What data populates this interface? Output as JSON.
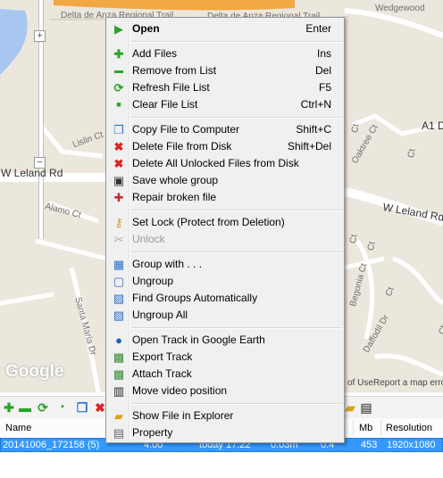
{
  "map": {
    "labels": {
      "delta_top": "Delta de Anza Regional Trail",
      "delta_mid": "Delta de Anza Regional Trail",
      "wedgewood": "Wedgewood",
      "w_leland_left": "W Leland Rd",
      "w_leland_right": "W Leland Rd",
      "lislin": "Lislin Ct",
      "alamo": "Alamo Ct",
      "santa_maria": "Santa Maria Dr",
      "oaktree": "Oaktree Ct",
      "a1_do": "A1 Do",
      "begonia": "Begonia Ct",
      "daffodil": "Daffodil Dr",
      "ct_a": "Ct",
      "ct_b": "Ct",
      "ct_c": "Ct",
      "ct_d": "Ct",
      "ct_e": "Ct",
      "ct_f": "Ct"
    },
    "zoom_in": "+",
    "zoom_out": "−",
    "logo": "Google",
    "terms": "of Use",
    "report": "Report a map erro"
  },
  "list": {
    "columns": {
      "name": "Name",
      "mb": "Mb",
      "resolution": "Resolution"
    },
    "row": {
      "name": "20141006_172158 (5)",
      "value": "4.00",
      "date": "today 17:22",
      "duration": "0.03m",
      "num": "0.4",
      "mb": "453",
      "resolution": "1920x1080"
    }
  },
  "menu": {
    "open": {
      "label": "Open",
      "shortcut": "Enter"
    },
    "add_files": {
      "label": "Add Files",
      "shortcut": "Ins"
    },
    "remove_from_list": {
      "label": "Remove from List",
      "shortcut": "Del"
    },
    "refresh_file_list": {
      "label": "Refresh File List",
      "shortcut": "F5"
    },
    "clear_file_list": {
      "label": "Clear File List",
      "shortcut": "Ctrl+N"
    },
    "copy_file_to_computer": {
      "label": "Copy File to Computer",
      "shortcut": "Shift+C"
    },
    "delete_file_from_disk": {
      "label": "Delete File from Disk",
      "shortcut": "Shift+Del"
    },
    "delete_all_unlocked": {
      "label": "Delete All Unlocked Files from Disk"
    },
    "save_whole_group": {
      "label": "Save whole group"
    },
    "repair_broken_file": {
      "label": "Repair broken file"
    },
    "set_lock": {
      "label": "Set Lock (Protect from Deletion)"
    },
    "unlock": {
      "label": "Unlock"
    },
    "group_with": {
      "label": "Group with . . ."
    },
    "ungroup": {
      "label": "Ungroup"
    },
    "find_groups": {
      "label": "Find Groups Automatically"
    },
    "ungroup_all": {
      "label": "Ungroup All"
    },
    "open_track_google_earth": {
      "label": "Open Track in Google Earth"
    },
    "export_track": {
      "label": "Export Track"
    },
    "attach_track": {
      "label": "Attach Track"
    },
    "move_video_position": {
      "label": "Move video position"
    },
    "show_file_in_explorer": {
      "label": "Show File in Explorer"
    },
    "property": {
      "label": "Property"
    }
  },
  "icons": {
    "open": "play-triangle-icon",
    "add_files": "green-plus-icon",
    "remove_from_list": "green-minus-icon",
    "refresh": "green-refresh-icon",
    "clear": "small-dot-icon",
    "copy": "copy-pages-icon",
    "delete": "red-x-icon",
    "save": "floppy-disk-icon",
    "repair": "first-aid-kit-icon",
    "lock": "key-icon",
    "unlock": "scissors-icon",
    "group": "group-add-icon",
    "globe": "globe-icon",
    "image": "picture-icon",
    "film": "film-icon",
    "folder": "folder-icon",
    "property": "document-icon"
  },
  "colors": {
    "selection": "#3399ff",
    "menu_bg": "#f0f0f0",
    "map_bg": "#ece7dd",
    "road_major": "#ffffff",
    "water": "#a8c7f0",
    "highway": "#f2a745"
  }
}
